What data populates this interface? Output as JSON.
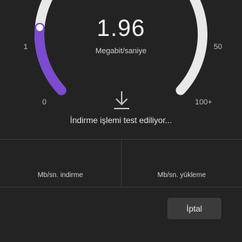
{
  "gauge": {
    "value": "1.96",
    "unit": "Megabit/saniye",
    "fill_fraction": 0.18,
    "ticks": {
      "min": "0",
      "low": "1",
      "high": "50",
      "max": "100+"
    },
    "colors": {
      "track": "#e9e9e9",
      "fill": "#7b4bd1",
      "knob": "#ffffff"
    }
  },
  "status": {
    "text": "İndirme işlemi test ediliyor..."
  },
  "results": {
    "download_label": "Mb/sn. indirme",
    "upload_label": "Mb/sn. yükleme"
  },
  "actions": {
    "cancel_label": "İptal"
  },
  "icons": {
    "download": "download-icon"
  }
}
